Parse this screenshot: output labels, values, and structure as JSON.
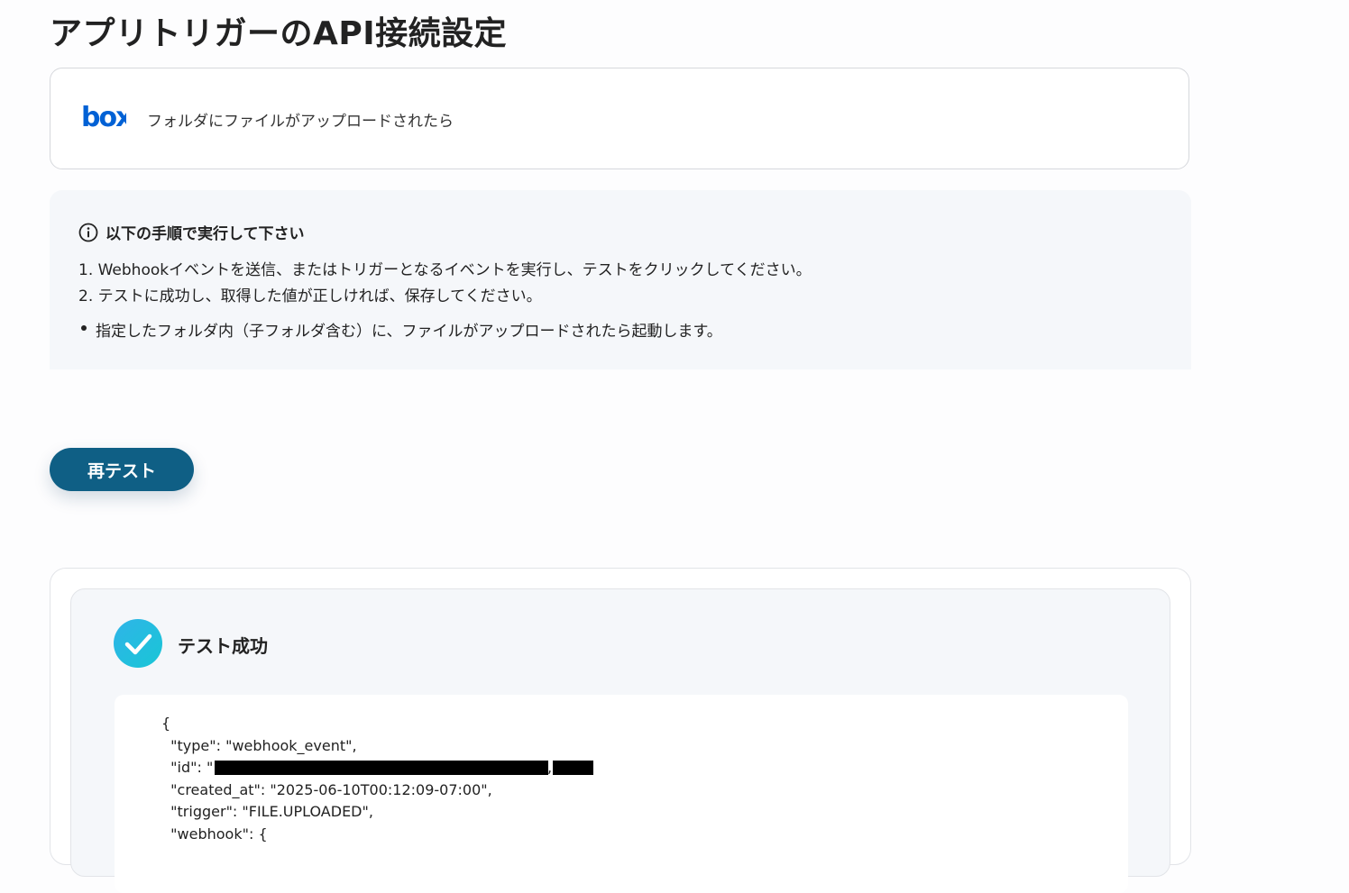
{
  "page": {
    "title": "アプリトリガーのAPI接続設定"
  },
  "trigger": {
    "app_logo_text": "box",
    "description": "フォルダにファイルがアップロードされたら"
  },
  "instructions": {
    "heading": "以下の手順で実行して下さい",
    "steps": [
      "1. Webhookイベントを送信、またはトリガーとなるイベントを実行し、テストをクリックしてください。",
      "2. テストに成功し、取得した値が正しければ、保存してください。"
    ],
    "note": "指定したフォルダ内（子フォルダ含む）に、ファイルがアップロードされたら起動します。"
  },
  "actions": {
    "retest_label": "再テスト"
  },
  "result": {
    "status_label": "テスト成功",
    "code_lines": [
      "{",
      "  \"type\": \"webhook_event\",",
      "  \"id\": \"",
      "  \"created_at\": \"2025-06-10T00:12:09-07:00\",",
      "  \"trigger\": \"FILE.UPLOADED\",",
      "  \"webhook\": {"
    ],
    "redacted_separator": ","
  },
  "colors": {
    "brand_box": "#0061d5",
    "button_bg": "#0f5f85",
    "success_gradient_start": "#2fb4e8",
    "success_gradient_end": "#19c6d6",
    "panel_bg": "#f5f7fa"
  },
  "icons": {
    "info": "info-circle-icon",
    "success": "check-circle-icon"
  }
}
